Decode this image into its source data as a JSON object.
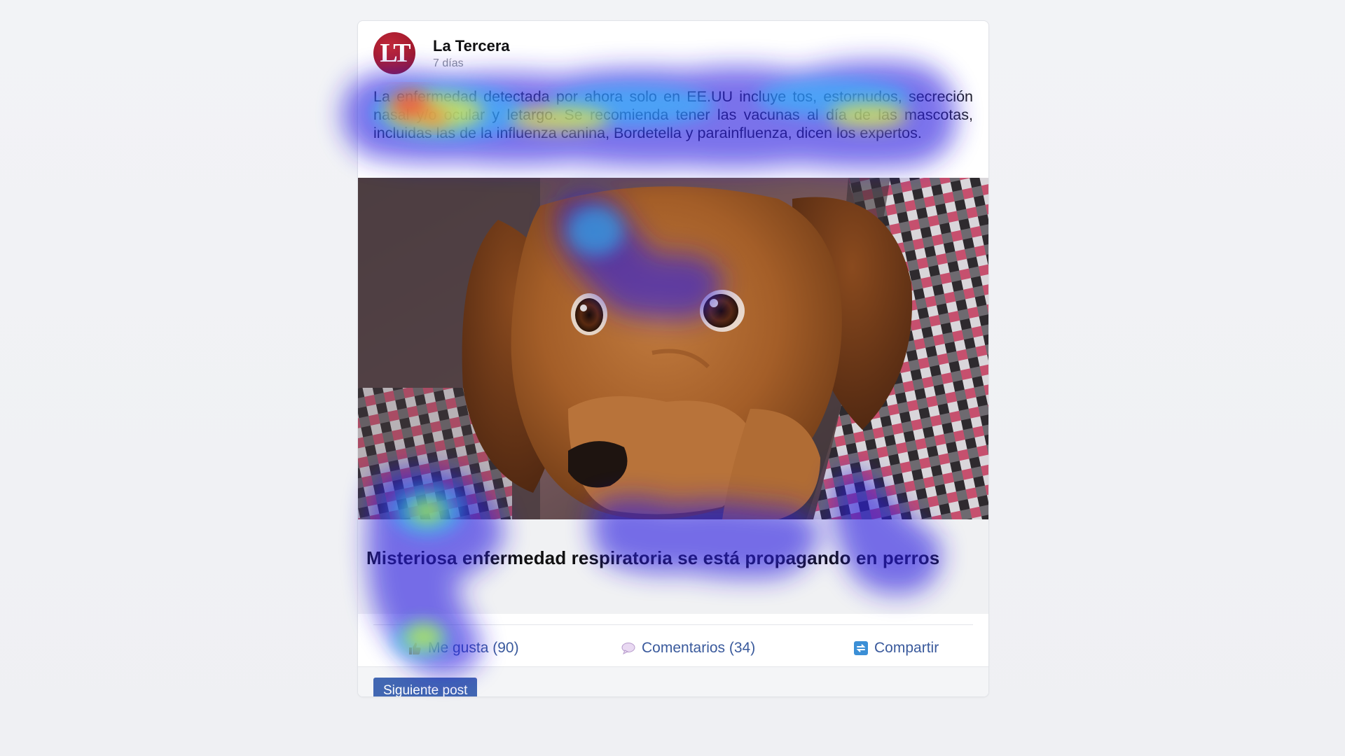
{
  "post": {
    "avatar_text": "LT",
    "author": "La Tercera",
    "time": "7 días",
    "text": "La enfermedad detectada por ahora solo en EE.UU incluye tos, estornudos, secreción nasal y/o ocular y letargo. Se recomienda tener las vacunas al día de las mascotas, incluidas las de la influenza canina, Bordetella y parainfluenza, dicen los expertos.",
    "link_title": "Misteriosa enfermedad respiratoria se está propagando en perros"
  },
  "actions": {
    "like_label": "Me gusta (90)",
    "comments_label": "Comentarios (34)",
    "share_label": "Compartir"
  },
  "footer": {
    "next_label": "Siguiente post"
  },
  "colors": {
    "brand_red": "#a51b2e",
    "action_blue": "#3a5a9c",
    "button_blue": "#4267b2"
  },
  "icons": {
    "like": "thumbs-up-icon",
    "comments": "speech-bubble-icon",
    "share": "share-icon"
  }
}
